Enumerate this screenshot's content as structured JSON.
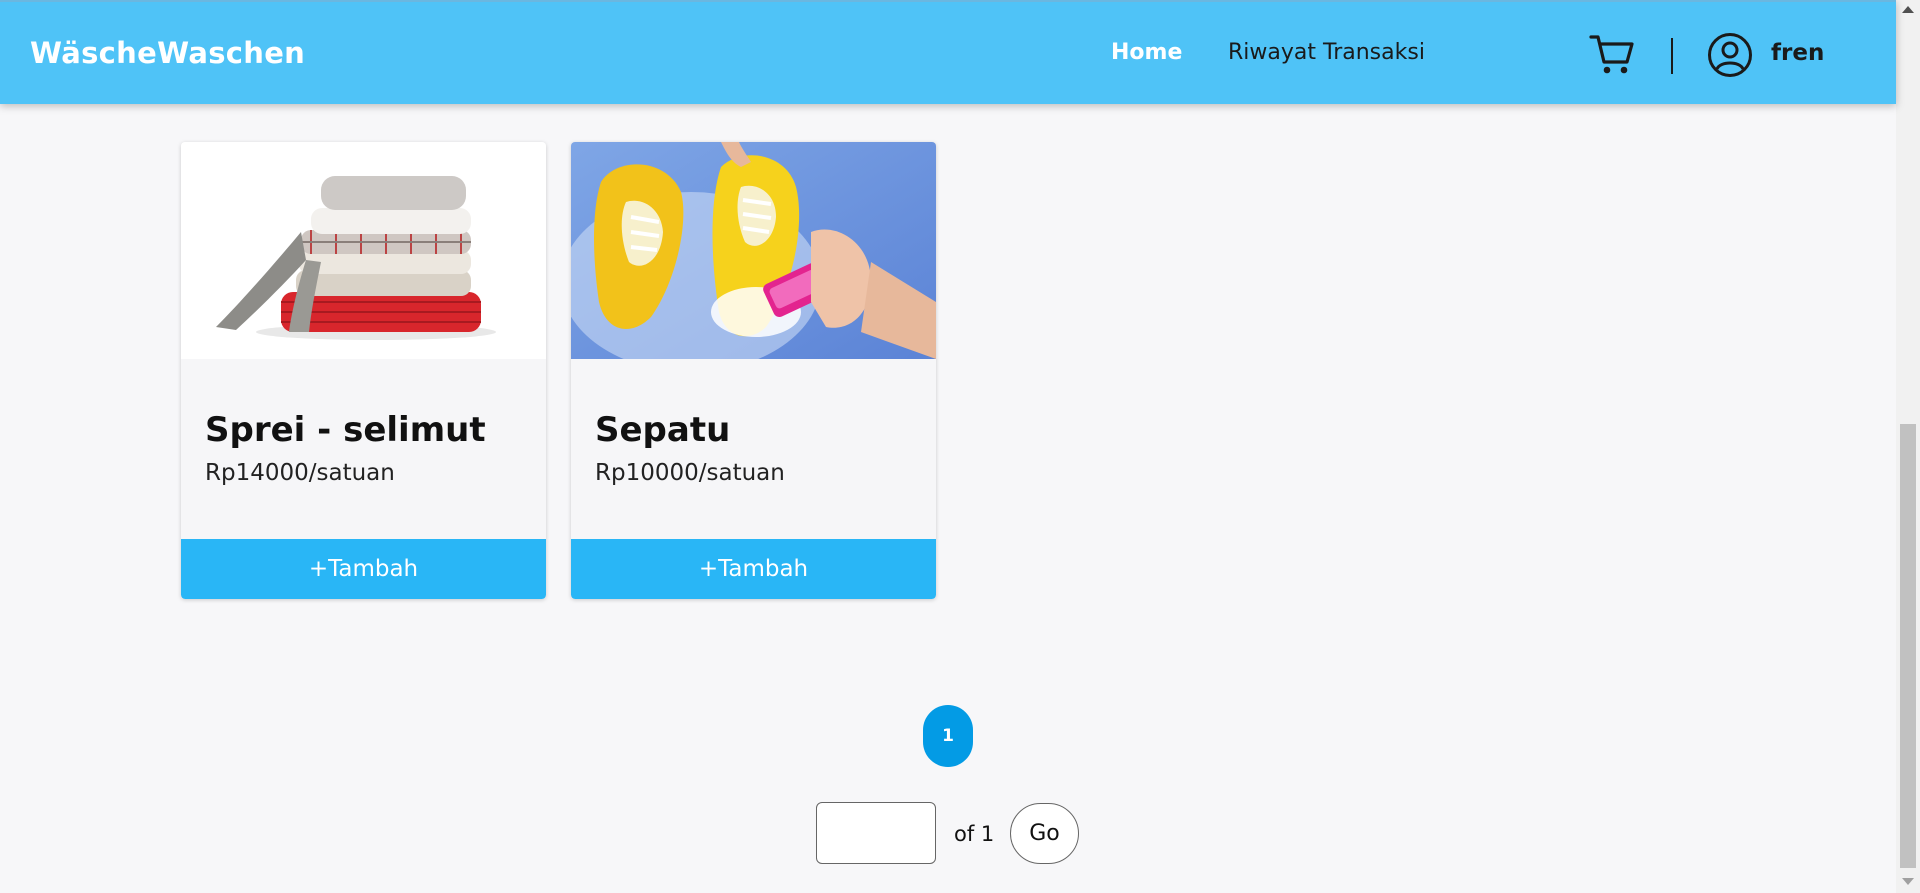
{
  "header": {
    "brand": "WäscheWaschen",
    "nav": {
      "home": "Home",
      "history": "Riwayat Transaksi"
    },
    "user_name": "fren",
    "icons": [
      "cart-icon",
      "user-circle-icon"
    ]
  },
  "products": [
    {
      "title": "Sprei - selimut",
      "price": "Rp14000/satuan",
      "button": "+Tambah",
      "image": "folded-blankets-photo"
    },
    {
      "title": "Sepatu",
      "price": "Rp10000/satuan",
      "button": "+Tambah",
      "image": "yellow-shoes-washing-photo"
    }
  ],
  "pagination": {
    "current_page": "1",
    "jump_input_value": "",
    "of_label": "of 1",
    "go_label": "Go"
  },
  "colors": {
    "navbar": "#4fc3f7",
    "button": "#29b6f6",
    "active_page": "#039be5",
    "background": "#f7f7f9"
  }
}
